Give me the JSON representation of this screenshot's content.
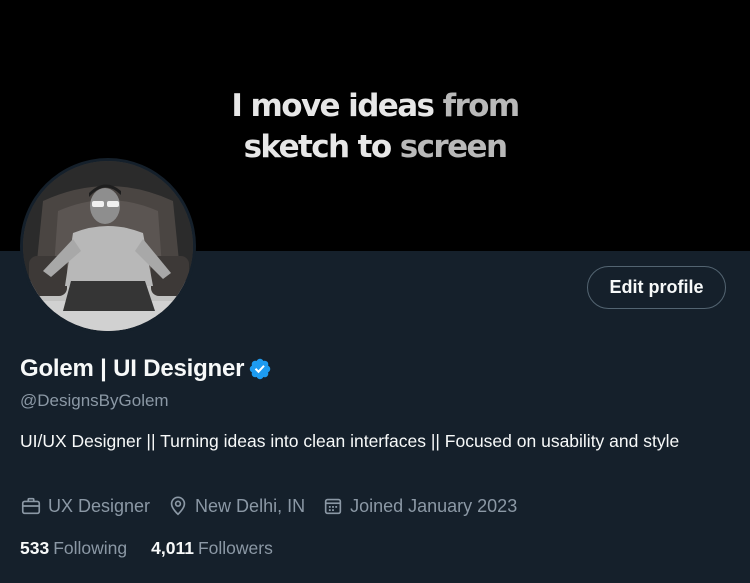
{
  "banner": {
    "line1_strong": "I move ideas ",
    "line1_fade": "from",
    "line2_strong": "sketch to ",
    "line2_fade": "screen"
  },
  "profile": {
    "name": "Golem | UI Designer",
    "handle": "@DesignsByGolem",
    "bio": "UI/UX Designer || Turning ideas into clean interfaces || Focused on usability and style",
    "verified_color": "#1d9bf0"
  },
  "actions": {
    "edit_profile_label": "Edit profile"
  },
  "meta": {
    "profession": "UX Designer",
    "profession_icon": "briefcase-icon",
    "location": "New Delhi, IN",
    "location_icon": "location-pin-icon",
    "joined": "Joined January 2023",
    "joined_icon": "calendar-icon"
  },
  "stats": {
    "following_count": "533",
    "following_label": "Following",
    "followers_count": "4,011",
    "followers_label": "Followers"
  },
  "colors": {
    "background": "#15202b",
    "banner": "#000000",
    "text_primary": "#f7f9f9",
    "text_secondary": "#8b98a5",
    "accent": "#1d9bf0"
  }
}
